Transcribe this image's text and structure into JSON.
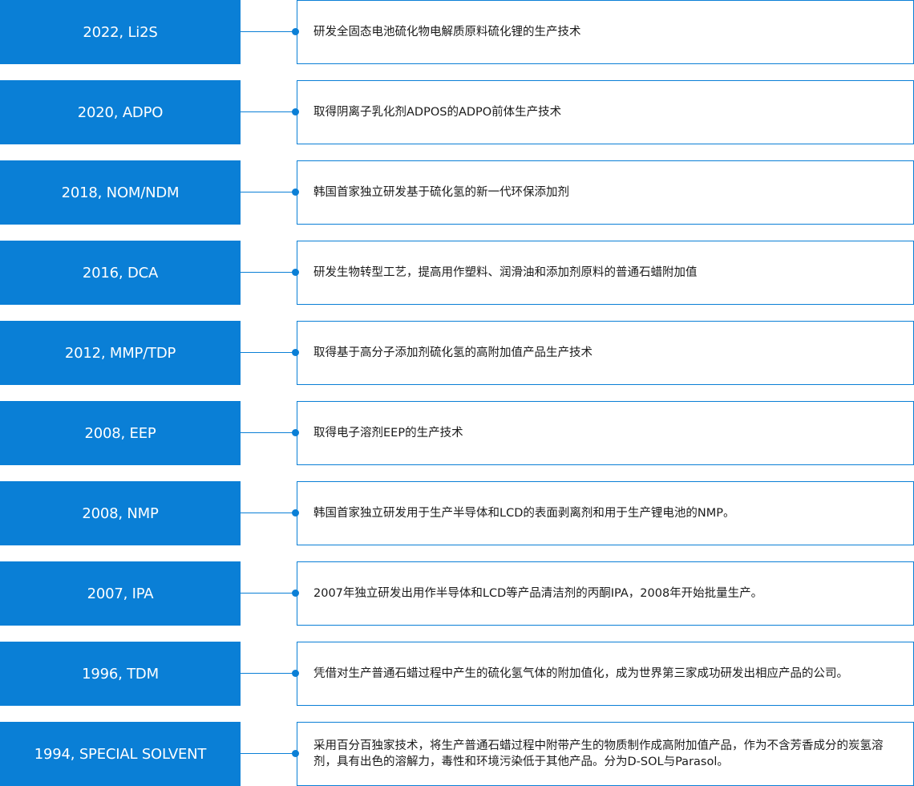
{
  "milestones": [
    {
      "year": "2022, Li2S",
      "description": "研发全固态电池硫化物电解质原料硫化锂的生产技术"
    },
    {
      "year": "2020, ADPO",
      "description": "取得阴离子乳化剂ADPOS的ADPO前体生产技术"
    },
    {
      "year": "2018, NOM/NDM",
      "description": "韩国首家独立研发基于硫化氢的新一代环保添加剂"
    },
    {
      "year": "2016, DCA",
      "description": "研发生物转型工艺，提高用作塑料、润滑油和添加剂原料的普通石蜡附加值"
    },
    {
      "year": "2012, MMP/TDP",
      "description": "取得基于高分子添加剂硫化氢的高附加值产品生产技术"
    },
    {
      "year": "2008, EEP",
      "description": "取得电子溶剂EEP的生产技术"
    },
    {
      "year": "2008, NMP",
      "description": "韩国首家独立研发用于生产半导体和LCD的表面剥离剂和用于生产锂电池的NMP。"
    },
    {
      "year": "2007, IPA",
      "description": "2007年独立研发出用作半导体和LCD等产品清洁剂的丙酮IPA，2008年开始批量生产。"
    },
    {
      "year": "1996, TDM",
      "description": "凭借对生产普通石蜡过程中产生的硫化氢气体的附加值化，成为世界第三家成功研发出相应产品的公司。"
    },
    {
      "year": "1994, SPECIAL SOLVENT",
      "description": "采用百分百独家技术，将生产普通石蜡过程中附带产生的物质制作成高附加值产品，作为不含芳香成分的炭氢溶剂，具有出色的溶解力，毒性和环境污染低于其他产品。分为D-SOL与Parasol。"
    }
  ],
  "colors": {
    "accent": "#0a7fd6",
    "text": "#1a1a1a",
    "background": "#ffffff"
  }
}
